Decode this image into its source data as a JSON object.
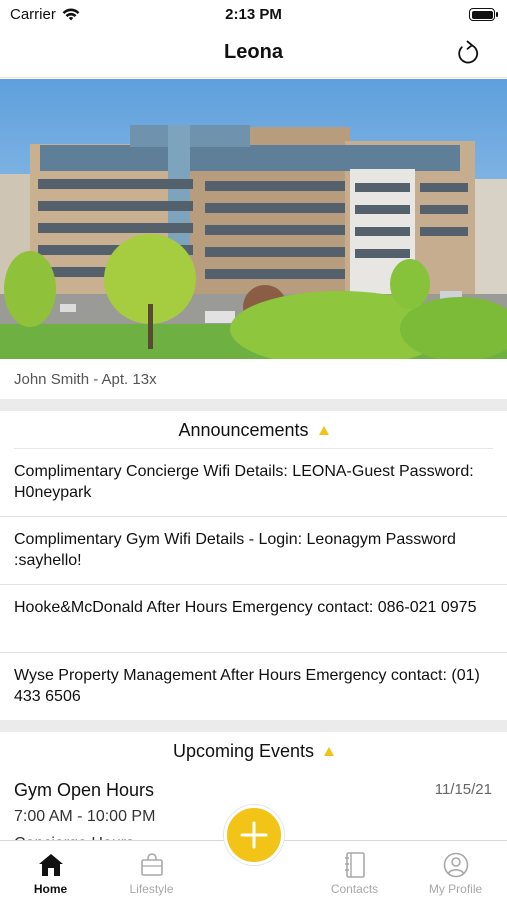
{
  "status_bar": {
    "carrier": "Carrier",
    "time": "2:13 PM",
    "battery_level": 1.0
  },
  "nav": {
    "title": "Leona",
    "refresh_icon": "refresh-icon"
  },
  "resident": {
    "label": "John Smith - Apt. 13x"
  },
  "announcements": {
    "title": "Announcements",
    "items": [
      {
        "text": "Complimentary Concierge Wifi Details: LEONA-Guest Password: H0neypark"
      },
      {
        "text": "Complimentary Gym Wifi Details - Login: Leonagym Password :sayhello!"
      },
      {
        "text": "Hooke&McDonald After Hours Emergency contact: 086-021 0975"
      },
      {
        "text": "Wyse Property Management After Hours Emergency contact: (01) 433 6506"
      }
    ]
  },
  "events": {
    "title": "Upcoming Events",
    "items": [
      {
        "title": "Gym Open Hours",
        "date": "11/15/21",
        "hours": "7:00 AM - 10:00 PM",
        "next": "Concierge Hours"
      }
    ]
  },
  "tab_bar": {
    "tabs": [
      {
        "label": "Home",
        "icon": "home-icon",
        "active": true
      },
      {
        "label": "Lifestyle",
        "icon": "shopping-bag-icon",
        "active": false
      },
      {
        "label": "Contacts",
        "icon": "address-book-icon",
        "active": false
      },
      {
        "label": "My Profile",
        "icon": "user-circle-icon",
        "active": false
      }
    ],
    "add_icon": "plus-icon"
  },
  "colors": {
    "accent": "#f2c417",
    "divider_band": "#ebebeb",
    "sky": "#7fb6e6",
    "foliage": "#8cc43c"
  }
}
